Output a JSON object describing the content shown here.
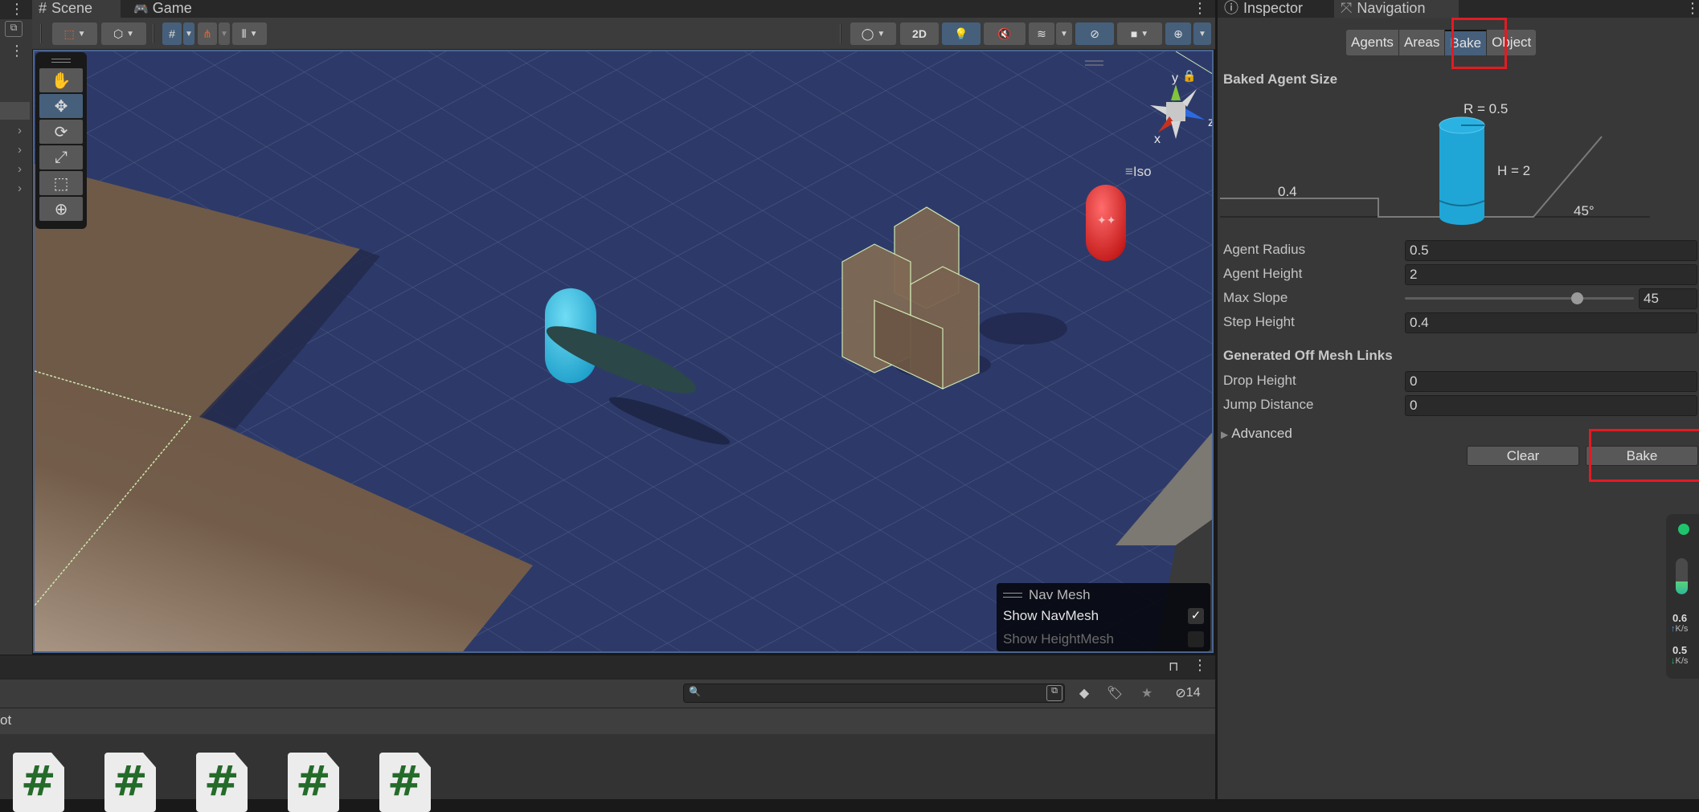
{
  "scene_tabs": [
    {
      "icon": "hash-icon",
      "label": "Scene",
      "active": true
    },
    {
      "icon": "gamepad-icon",
      "label": "Game",
      "active": false
    }
  ],
  "scene_toolbar": {
    "buttons_left": [
      "draw-mode",
      "render-mode",
      "grid-snap",
      "increment-snap",
      "grid-visibility"
    ],
    "buttons_right": [
      "shading-mode",
      "2D",
      "lighting",
      "audio",
      "effects",
      "visibility",
      "camera",
      "gizmos"
    ],
    "toggle_2d_label": "2D"
  },
  "tools": [
    {
      "name": "hand-tool",
      "glyph": "✋",
      "active": false
    },
    {
      "name": "move-tool",
      "glyph": "✥",
      "active": true
    },
    {
      "name": "rotate-tool",
      "glyph": "⟳",
      "active": false
    },
    {
      "name": "scale-tool",
      "glyph": "⤢",
      "active": false
    },
    {
      "name": "rect-tool",
      "glyph": "⬚",
      "active": false
    },
    {
      "name": "transform-tool",
      "glyph": "⊕",
      "active": false
    }
  ],
  "gizmo": {
    "x_label": "x",
    "y_label": "y",
    "z_label": "z",
    "projection_label": "Iso"
  },
  "navmesh_overlay": {
    "title": "Nav Mesh",
    "show_navmesh_label": "Show NavMesh",
    "show_navmesh_checked": true,
    "show_heightmesh_label": "Show HeightMesh",
    "show_heightmesh_checked": false,
    "check_glyph": "✓"
  },
  "project": {
    "breadcrumb_fragment": "ot",
    "hidden_count": "14",
    "search_placeholder": "",
    "file_glyph": "#",
    "files": 5
  },
  "inspector": {
    "tabs": [
      {
        "label": "Inspector",
        "icon": "info-icon",
        "active": false
      },
      {
        "label": "Navigation",
        "icon": "navigation-icon",
        "active": true
      }
    ],
    "segments": [
      {
        "label": "Agents",
        "active": false
      },
      {
        "label": "Areas",
        "active": false
      },
      {
        "label": "Bake",
        "active": true
      },
      {
        "label": "Object",
        "active": false
      }
    ],
    "baked_agent_size_title": "Baked Agent Size",
    "diagram": {
      "radius_label": "R = 0.5",
      "height_label": "H = 2",
      "step_label": "0.4",
      "slope_label": "45°"
    },
    "fields": [
      {
        "label": "Agent Radius",
        "value": "0.5"
      },
      {
        "label": "Agent Height",
        "value": "2"
      },
      {
        "label": "Max Slope",
        "value": "45",
        "slider": true,
        "slider_min": 0,
        "slider_max": 60,
        "slider_value": 45
      },
      {
        "label": "Step Height",
        "value": "0.4"
      }
    ],
    "offmesh_title": "Generated Off Mesh Links",
    "offmesh_fields": [
      {
        "label": "Drop Height",
        "value": "0"
      },
      {
        "label": "Jump Distance",
        "value": "0"
      }
    ],
    "advanced_label": "Advanced",
    "clear_label": "Clear",
    "bake_label": "Bake"
  },
  "net_status": {
    "status_color": "#1ec46c",
    "up_value": "0.6",
    "up_unit": "K/s",
    "down_value": "0.5",
    "down_unit": "K/s",
    "level": 0.35
  },
  "colors": {
    "accent": "#46607c",
    "highlight_box": "#e21b23",
    "navmesh_blue": "#2c3966",
    "ground_brown": "#6f5a48",
    "agent_cyan": "#1ea8d6",
    "enemy_red": "#d61f1f"
  }
}
